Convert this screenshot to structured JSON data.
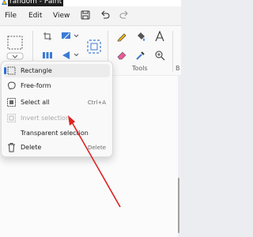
{
  "window": {
    "title": "random - Paint"
  },
  "menubar": {
    "items": [
      {
        "label": "File"
      },
      {
        "label": "Edit"
      },
      {
        "label": "View"
      }
    ],
    "icons": [
      "save-icon",
      "undo-icon",
      "redo-icon"
    ]
  },
  "ribbon": {
    "tools_label": "Tools",
    "next_group_label": "B",
    "icons": [
      "select-rectangle-icon",
      "crop-icon",
      "resize-icon",
      "flip-icon",
      "rotate-icon",
      "image-search-icon",
      "pencil-icon",
      "fill-icon",
      "text-icon",
      "eraser-icon",
      "color-picker-icon",
      "magnifier-icon"
    ]
  },
  "selection_menu": {
    "items": [
      {
        "label": "Rectangle",
        "icon": "rectangle-select-icon",
        "selected": true
      },
      {
        "label": "Free-form",
        "icon": "freeform-select-icon"
      },
      {
        "label": "Select all",
        "icon": "select-all-icon",
        "shortcut": "Ctrl+A"
      },
      {
        "label": "Invert selection",
        "icon": "invert-selection-icon",
        "disabled": true
      },
      {
        "label": "Transparent selection",
        "icon": ""
      },
      {
        "label": "Delete",
        "icon": "trash-icon",
        "shortcut": "Delete"
      }
    ]
  },
  "colors": {
    "accent": "#2a6fd6",
    "annotation_arrow": "#e02020"
  }
}
